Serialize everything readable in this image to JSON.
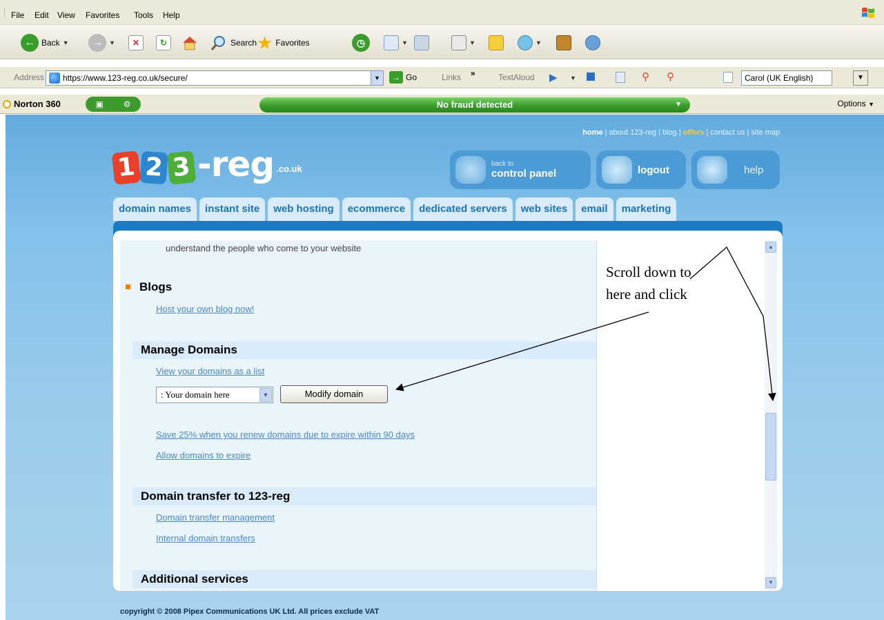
{
  "menubar": {
    "items": [
      "File",
      "Edit",
      "View",
      "Favorites",
      "Tools",
      "Help"
    ]
  },
  "toolbar": {
    "back_label": "Back",
    "search_label": "Search",
    "favorites_label": "Favorites"
  },
  "addressbar": {
    "label": "Address",
    "url": "https://www.123-reg.co.uk/secure/",
    "go_label": "Go",
    "links_label": "Links",
    "chevron": "»",
    "textaloud_label": "TextAloud",
    "voice_value": "Carol (UK English)"
  },
  "norton": {
    "name": "Norton 360",
    "status": "No fraud detected",
    "options_label": "Options"
  },
  "site": {
    "brand": "-reg",
    "logo_digits": [
      "1",
      "2",
      "3"
    ],
    "domain_suffix": ".co.uk",
    "toplinks": {
      "home": "home",
      "about": "about 123-reg",
      "blog": "blog",
      "offers": "offers",
      "contact": "contact us",
      "sitemap": "site map"
    },
    "header_buttons": {
      "control_small": "back to",
      "control_big": "control panel",
      "logout": "logout",
      "help": "help"
    },
    "nav_tabs": [
      "domain names",
      "instant site",
      "web hosting",
      "ecommerce",
      "dedicated servers",
      "web sites",
      "email",
      "marketing"
    ],
    "content": {
      "intro": "understand the people who come to your website",
      "blogs_title": "Blogs",
      "blogs_link": "Host your own blog now!",
      "manage_title": "Manage Domains",
      "view_list_link": "View your domains as a list",
      "domain_select_value": "Your domain here",
      "modify_button": "Modify domain",
      "renew_link": "Save 25% when you renew domains due to expire within 90 days",
      "expire_link": "Allow domains to expire",
      "transfer_title": "Domain transfer to 123-reg",
      "transfer_mgmt_link": "Domain transfer management",
      "internal_transfers_link": "Internal domain transfers",
      "additional_title": "Additional services"
    },
    "annotation_line1": "Scroll down to",
    "annotation_line2": "here and click",
    "copyright": "copyright © 2008 Pipex Communications UK Ltd. All prices exclude VAT"
  },
  "colors": {
    "site_blue": "#1b7ac4",
    "tab_bg": "#d9ebf8",
    "link": "#4a88c8",
    "norton_green": "#3a9c2a",
    "logo_red": "#e8402a",
    "logo_blue": "#2e86d1",
    "logo_green": "#4caf3c",
    "offers": "#ffcc33"
  }
}
